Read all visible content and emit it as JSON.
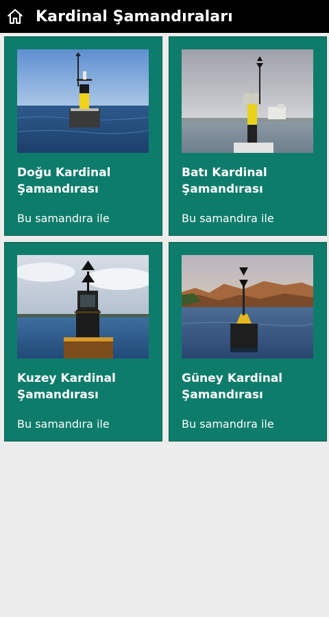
{
  "app_bar": {
    "title": "Kardinal Şamandıraları",
    "home_icon": "home-icon"
  },
  "colors": {
    "app_bar": "#000000",
    "card": "#0e7c6b",
    "background": "#ececec",
    "text": "#ffffff"
  },
  "cards": [
    {
      "title": "Doğu Kardinal Şamandırası",
      "subtitle": "Bu samandıra ile",
      "image": "east-cardinal-buoy-photo"
    },
    {
      "title": "Batı Kardinal Şamandırası",
      "subtitle": "Bu samandıra ile",
      "image": "west-cardinal-buoy-photo"
    },
    {
      "title": "Kuzey Kardinal Şamandırası",
      "subtitle": "Bu samandıra ile",
      "image": "north-cardinal-buoy-photo"
    },
    {
      "title": "Güney Kardinal Şamandırası",
      "subtitle": "Bu samandıra ile",
      "image": "south-cardinal-buoy-photo"
    }
  ]
}
